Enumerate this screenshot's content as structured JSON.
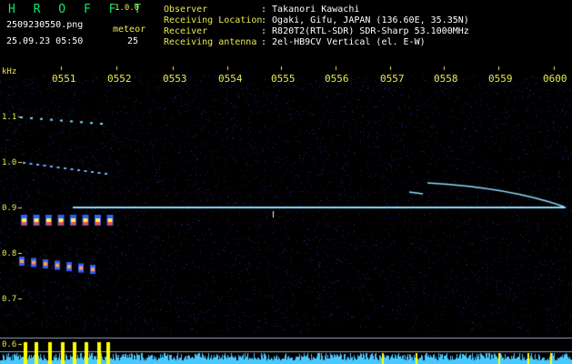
{
  "app": {
    "name": "H R O F F T",
    "version": "1.0.0"
  },
  "file": {
    "filename": "2509230550.png",
    "datetime": "25.09.23 05:50"
  },
  "meteor": {
    "label": "meteor",
    "count": "25"
  },
  "station": [
    {
      "label": "Observer",
      "value": ": Takanori Kawachi"
    },
    {
      "label": "Receiving Location",
      "value": ": Ogaki, Gifu, JAPAN (136.60E, 35.35N)"
    },
    {
      "label": "Receiver",
      "value": ": R820T2(RTL-SDR) SDR-Sharp 53.1000MHz"
    },
    {
      "label": "Receiving antenna",
      "value": ": 2el-HB9CV Vertical (el. E-W)"
    }
  ],
  "axis": {
    "unit": "kHz",
    "time_ticks": [
      "0551",
      "0552",
      "0553",
      "0554",
      "0555",
      "0556",
      "0557",
      "0558",
      "0559",
      "0600"
    ],
    "freq_ticks": [
      "1.1",
      "1.0",
      "0.9",
      "0.8",
      "0.7",
      "0.6"
    ]
  },
  "colors": {
    "title": "#17e36b",
    "label": "#e9e94f",
    "text": "#ffffff",
    "carrier": "#8fdcff",
    "meteor_hot": "#ff4a2a",
    "level_bar": "#ffff00",
    "noise_bar": "#49c8ff"
  }
}
